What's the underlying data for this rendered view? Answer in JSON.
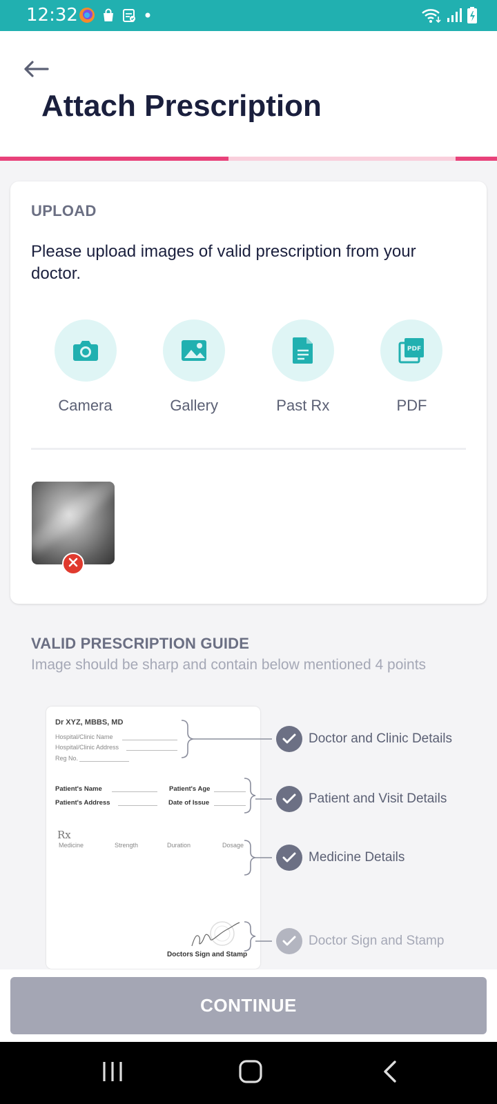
{
  "status_bar": {
    "time": "12:32",
    "left_icons": [
      "firefox-icon",
      "shopping-bag-icon",
      "clipboard-icon",
      "dot-icon"
    ],
    "right_icons": [
      "wifi-icon",
      "signal-icon",
      "battery-charging-icon"
    ]
  },
  "header": {
    "title": "Attach Prescription",
    "back_icon": "arrow-left-icon",
    "progress_fraction": 0.46
  },
  "upload": {
    "section_label": "UPLOAD",
    "instruction": "Please upload images of valid prescription from your doctor.",
    "options": [
      {
        "label": "Camera",
        "icon": "camera-icon"
      },
      {
        "label": "Gallery",
        "icon": "gallery-icon"
      },
      {
        "label": "Past Rx",
        "icon": "document-icon"
      },
      {
        "label": "PDF",
        "icon": "pdf-icon"
      }
    ],
    "uploaded_count": 1
  },
  "guide": {
    "title": "VALID PRESCRIPTION GUIDE",
    "subtitle": "Image should be sharp and contain below mentioned 4 points",
    "items": [
      {
        "label": "Doctor and Clinic Details",
        "faded": false
      },
      {
        "label": "Patient and Visit Details",
        "faded": false
      },
      {
        "label": "Medicine Details",
        "faded": false
      },
      {
        "label": "Doctor Sign and Stamp",
        "faded": true
      }
    ],
    "sample": {
      "doctor": "Dr XYZ, MBBS, MD",
      "hospital_name": "Hospital/Clinic Name",
      "hospital_address": "Hospital/Clinic Address",
      "reg_no": "Reg No.",
      "patient_name": "Patient's Name",
      "patient_age": "Patient's Age",
      "patient_address": "Patient's Address",
      "date_of_issue": "Date of Issue",
      "rx": "Rx",
      "columns": [
        "Medicine",
        "Strength",
        "Duration",
        "Dosage"
      ],
      "sign_label": "Doctors Sign and Stamp"
    }
  },
  "footer": {
    "continue_label": "CONTINUE"
  },
  "nav_bar": {
    "buttons": [
      "recent-apps-icon",
      "home-icon",
      "back-icon"
    ]
  },
  "colors": {
    "status_bar": "#21b0b0",
    "accent_pink": "#e8427a",
    "icon_teal": "#21b0b0",
    "icon_bg": "#dff5f5",
    "title": "#1a1f3d",
    "button_disabled": "#a4a6b4"
  }
}
